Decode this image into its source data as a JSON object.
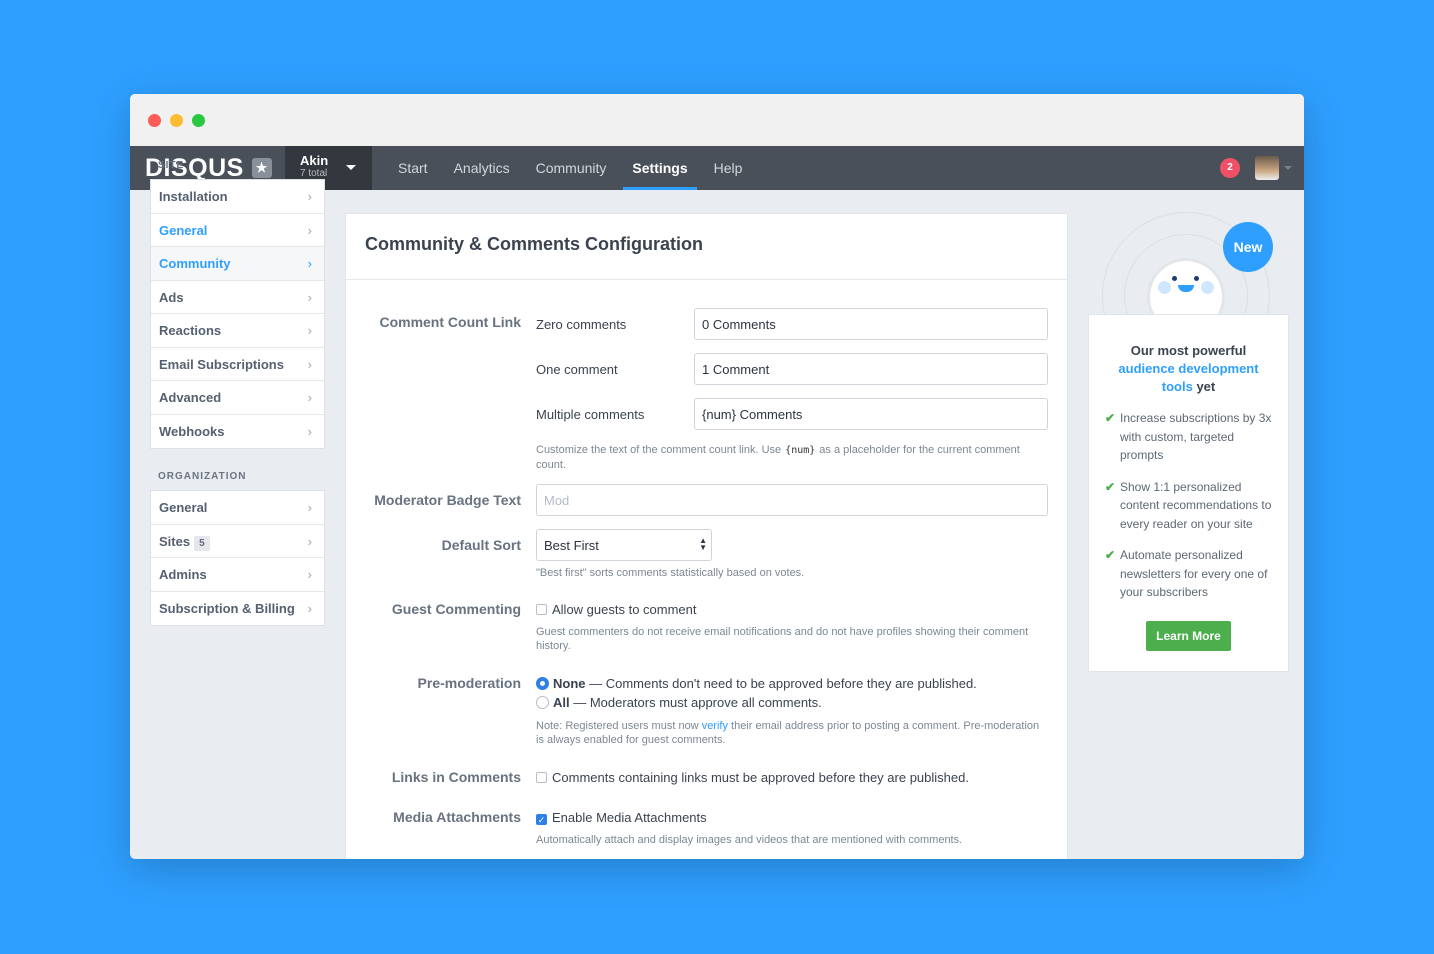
{
  "nav": {
    "logo": "DISQUS",
    "account_name": "Akin",
    "account_total": "7 total",
    "links": [
      "Start",
      "Analytics",
      "Community",
      "Settings",
      "Help"
    ],
    "active": "Settings",
    "notifications": "2"
  },
  "sidebar": {
    "site_heading": "SITE",
    "site_items": [
      "Installation",
      "General",
      "Community",
      "Ads",
      "Reactions",
      "Email Subscriptions",
      "Advanced",
      "Webhooks"
    ],
    "org_heading": "ORGANIZATION",
    "org_items": [
      "General",
      "Sites",
      "Admins",
      "Subscription & Billing"
    ],
    "sites_count": "5"
  },
  "main": {
    "title": "Community & Comments Configuration",
    "comment_count": {
      "label": "Comment Count Link",
      "zero_label": "Zero comments",
      "zero_value": "0 Comments",
      "one_label": "One comment",
      "one_value": "1 Comment",
      "multi_label": "Multiple comments",
      "multi_value": "{num} Comments",
      "help_a": "Customize the text of the comment count link. Use",
      "help_code": "{num}",
      "help_b": "as a placeholder for the current comment count."
    },
    "badge": {
      "label": "Moderator Badge Text",
      "placeholder": "Mod"
    },
    "sort": {
      "label": "Default Sort",
      "value": "Best First",
      "help": "\"Best first\" sorts comments statistically based on votes."
    },
    "guest": {
      "label": "Guest Commenting",
      "option": "Allow guests to comment",
      "checked": false,
      "help": "Guest commenters do not receive email notifications and do not have profiles showing their comment history."
    },
    "premod": {
      "label": "Pre-moderation",
      "none_bold": "None",
      "none_text": " — Comments don't need to be approved before they are published.",
      "all_bold": "All",
      "all_text": " — Moderators must approve all comments.",
      "selected": "None",
      "note_a": "Note: Registered users must now ",
      "note_link": "verify",
      "note_b": " their email address prior to posting a comment. Pre-moderation is always enabled for guest comments."
    },
    "links": {
      "label": "Links in Comments",
      "option": "Comments containing links must be approved before they are published.",
      "checked": false
    },
    "media": {
      "label": "Media Attachments",
      "option": "Enable Media Attachments",
      "checked": true,
      "help": "Automatically attach and display images and videos that are mentioned with comments."
    }
  },
  "promo": {
    "bubble": "New",
    "title_a": "Our most powerful",
    "title_link": "audience development tools",
    "title_b": "yet",
    "items": [
      "Increase subscriptions by 3x with custom, targeted prompts",
      "Show 1:1 personalized content recommendations to every reader on your site",
      "Automate personalized newsletters for every one of your subscribers"
    ],
    "button": "Learn More"
  }
}
